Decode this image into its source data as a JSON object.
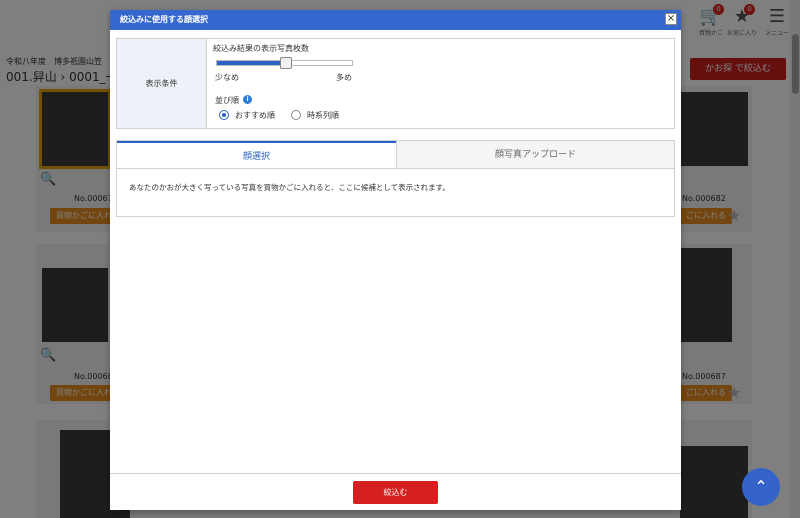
{
  "background": {
    "breadcrumb_small": "令和八年度　博多祇園山笠",
    "breadcrumb": "001.舁山 › 0001_一",
    "cart_icon": "cart-icon",
    "cart_count": "0",
    "cart_caption": "買物かご",
    "favorite_icon": "star-icon",
    "favorite_count": "0",
    "favorite_caption": "お気に入り",
    "menu_icon": "hamburger-icon",
    "menu_caption": "メニュー",
    "face_search_label": "かお探 で絞込む",
    "photos": [
      {
        "number": "No.00067",
        "cart_label": "買物かごに入れ"
      },
      {
        "number": "No.000682",
        "cart_label": "ごに入れる"
      },
      {
        "number": "No.00068",
        "cart_label": "買物かごに入れ"
      },
      {
        "number": "No.000687",
        "cart_label": "ごに入れる"
      }
    ]
  },
  "modal": {
    "title": "絞込みに使用する顔選択",
    "close_label": "×",
    "condition_label": "表示条件",
    "count_label": "絞込み結果の表示写真枚数",
    "slider_value": 0.5,
    "slider_min_label": "少なめ",
    "slider_max_label": "多め",
    "sort_label": "並び順",
    "info_icon": "i",
    "sort_options": [
      {
        "label": "おすすめ順",
        "selected": true
      },
      {
        "label": "時系列順",
        "selected": false
      }
    ],
    "tabs": [
      {
        "label": "顔選択",
        "active": true
      },
      {
        "label": "顔写真アップロード",
        "active": false
      }
    ],
    "tab_message": "あなたのかおが大きく写っている写真を買物かごに入れると、ここに候補として表示されます。",
    "submit_label": "絞込む"
  },
  "colors": {
    "header_blue": "#3568cf",
    "accent_red": "#d6201f",
    "cart_orange": "#e78a1e"
  }
}
